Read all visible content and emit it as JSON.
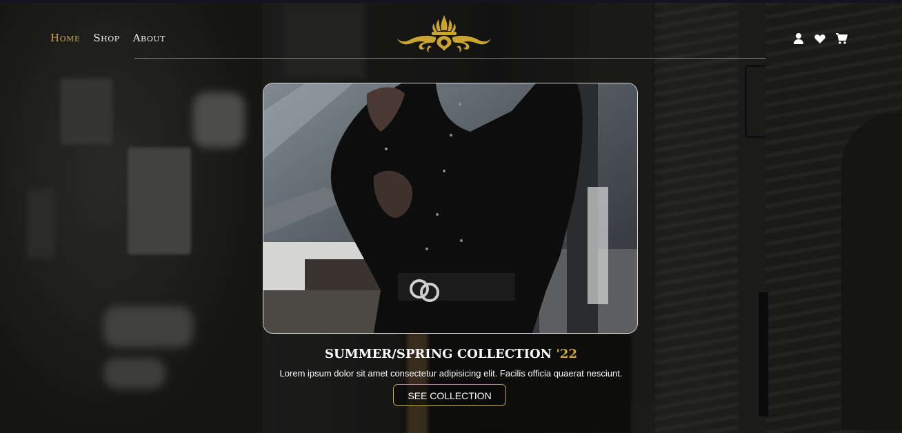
{
  "nav": {
    "items": [
      {
        "label": "Home",
        "active": true
      },
      {
        "label": "Shop",
        "active": false
      },
      {
        "label": "About",
        "active": false
      }
    ]
  },
  "header": {
    "logo_icon": "ornamental-crest-icon",
    "action_icons": [
      "user-icon",
      "heart-icon",
      "cart-icon"
    ]
  },
  "hero": {
    "title": "SUMMER/SPRING COLLECTION",
    "title_year": "'22",
    "description": "Lorem ipsum dolor sit amet consectetur adipisicing elit. Facilis officia quaerat nesciunt.",
    "cta_label": "SEE COLLECTION"
  },
  "colors": {
    "accent_gold": "#c9a84c",
    "year_gold": "#d2a532",
    "text": "#ffffff",
    "background": "#141414"
  }
}
